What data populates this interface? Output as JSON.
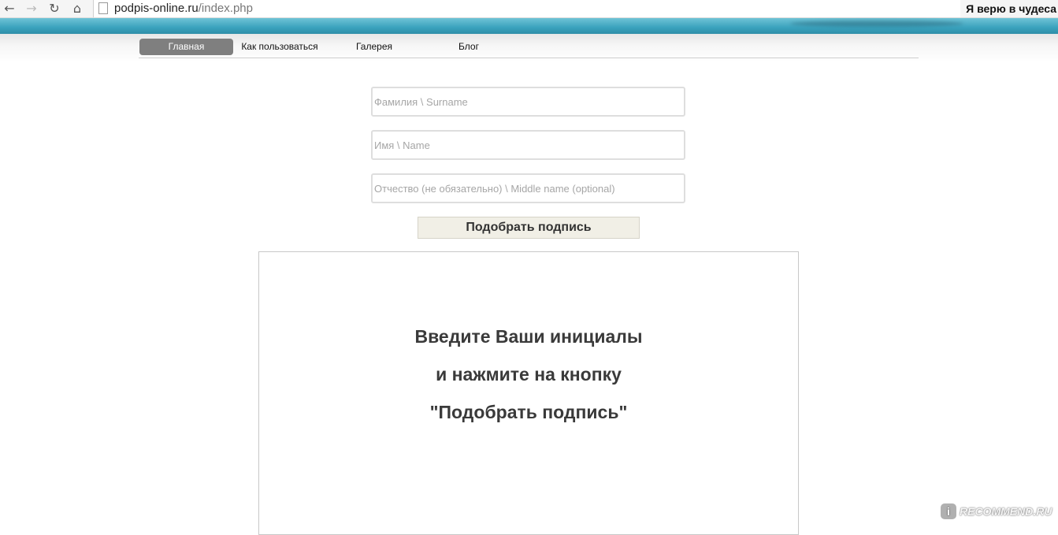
{
  "browser": {
    "back_icon": "arrow-left-icon",
    "back_glyph": "←",
    "forward_icon": "arrow-right-icon",
    "forward_glyph": "→",
    "reload_icon": "reload-icon",
    "reload_glyph": "↻",
    "home_icon": "home-icon",
    "home_glyph": "⌂",
    "url_host": "podpis-online.ru",
    "url_path": "/index.php",
    "extension_text": "Я верю в чудеса"
  },
  "nav": {
    "items": [
      {
        "label": "Главная",
        "active": true
      },
      {
        "label": "Как пользоваться",
        "active": false
      },
      {
        "label": "Галерея",
        "active": false
      },
      {
        "label": "Блог",
        "active": false
      }
    ]
  },
  "form": {
    "surname_placeholder": "Фамилия \\ Surname",
    "name_placeholder": "Имя \\ Name",
    "middle_placeholder": "Отчество (не обязательно) \\ Middle name (optional)",
    "submit_label": "Подобрать подпись"
  },
  "result": {
    "lines": [
      "Введите Ваши инициалы",
      "и нажмите на кнопку",
      "\"Подобрать подпись\""
    ]
  },
  "watermark": {
    "badge": "i",
    "text": "RECOMMEND.RU"
  },
  "colors": {
    "header_blue": "#3aa2bd",
    "active_tab": "#7f7f7f",
    "button_bg": "#f1efe6"
  }
}
